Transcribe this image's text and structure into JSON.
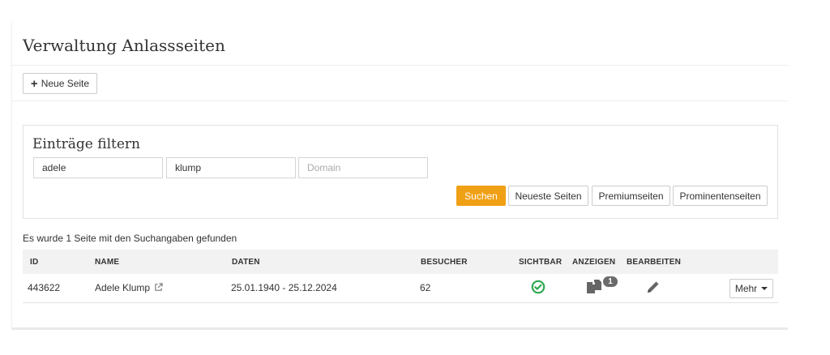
{
  "page": {
    "title": "Verwaltung Anlassseiten"
  },
  "toolbar": {
    "new_page_label": "Neue Seite"
  },
  "filter": {
    "title": "Einträge filtern",
    "first_name_value": "adele",
    "last_name_value": "klump",
    "domain_placeholder": "Domain",
    "buttons": {
      "search": "Suchen",
      "newest": "Neueste Seiten",
      "premium": "Premiumseiten",
      "prominent": "Prominentenseiten"
    },
    "accent_color": "#f0a015"
  },
  "results": {
    "summary": "Es wurde 1 Seite mit den Suchangaben gefunden",
    "columns": [
      "ID",
      "NAME",
      "DATEN",
      "BESUCHER",
      "SICHTBAR",
      "ANZEIGEN",
      "BEARBEITEN"
    ],
    "rows": [
      {
        "id": "443622",
        "name": "Adele Klump",
        "dates": "25.01.1940 - 25.12.2024",
        "visitors": "62",
        "visible_icon": "check-circle-icon",
        "ads_icon": "files-icon",
        "ads_count": "1",
        "edit_icon": "pencil-icon",
        "more_label": "Mehr"
      }
    ],
    "visible_color": "#2fa84f"
  }
}
